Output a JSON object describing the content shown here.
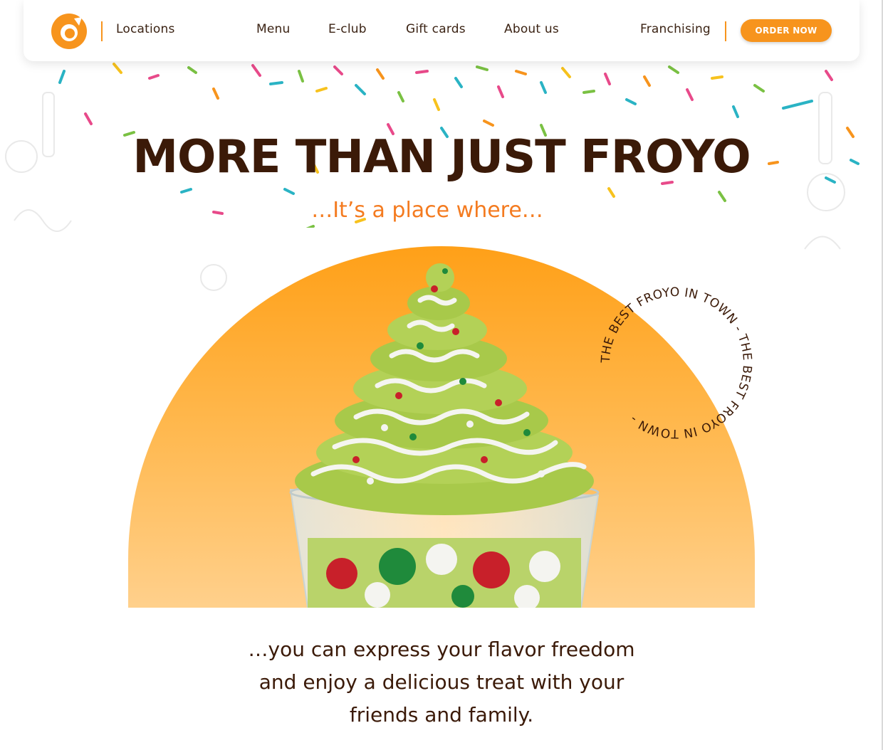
{
  "header": {
    "locations_label": "Locations",
    "nav": [
      {
        "label": "Menu"
      },
      {
        "label": "E-club"
      },
      {
        "label": "Gift cards"
      },
      {
        "label": "About us"
      }
    ],
    "franchising_label": "Franchising",
    "order_button_label": "ORDER NOW",
    "logo_icon": "orange-swirl-logo-icon"
  },
  "hero": {
    "title": "MORE THAN JUST FROYO",
    "subtitle": "…It’s a place where…",
    "badge_text": "THE BEST FROYO IN TOWN - THE BEST FROYO IN TOWN -",
    "body_line_1": "…you can express your flavor freedom",
    "body_line_2": "and enjoy a delicious treat with your",
    "body_line_3": "friends and family."
  },
  "colors": {
    "brand_orange": "#f7941d",
    "subtitle_orange": "#f47b20",
    "dark_brown": "#3b1a08",
    "froyo_green": "#a8c94a"
  }
}
